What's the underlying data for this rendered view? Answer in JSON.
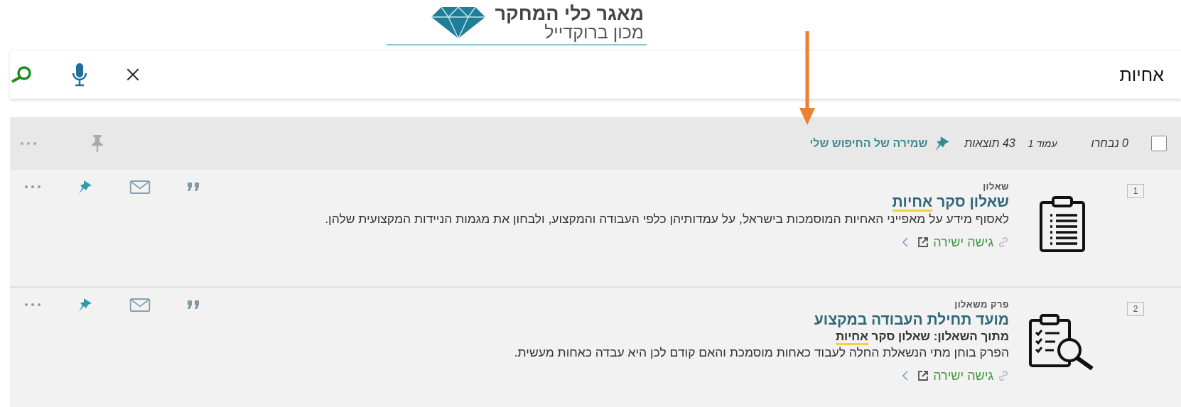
{
  "logo": {
    "title": "מאגר כלי המחקר",
    "subtitle": "מכון ברוקדייל"
  },
  "search": {
    "value": "אחיות"
  },
  "toolbar": {
    "select_all_checked": false,
    "selected_count": "0 נבחרו",
    "page": "עמוד 1",
    "results": "43 תוצאות",
    "save_search": "שמירה של החיפוש שלי"
  },
  "results": [
    {
      "number": "1",
      "kind": "questionnaire",
      "type_label": "שאלון",
      "title": "שאלון סקר",
      "title_highlight": "אחיות",
      "description": "לאסוף מידע על מאפייני האחיות המוסמכות בישראל, על עמדותיהן כלפי העבודה והמקצוע, ולבחון את מגמות הניידות המקצועית שלהן.",
      "direct_access": "גישה ישירה",
      "pinned": true
    },
    {
      "number": "2",
      "kind": "chapter",
      "type_label": "פרק משאלון",
      "title": "מועד תחילת העבודה במקצוע",
      "source": {
        "label": "מתוך השאלון:",
        "text": "שאלון סקר",
        "highlight": "אחיות"
      },
      "description": "הפרק בוחן מתי הנשאלת החלה לעבוד כאחות מוסמכת והאם קודם לכן היא עבדה כאחות מעשית.",
      "direct_access": "גישה ישירה",
      "pinned": true
    }
  ]
}
